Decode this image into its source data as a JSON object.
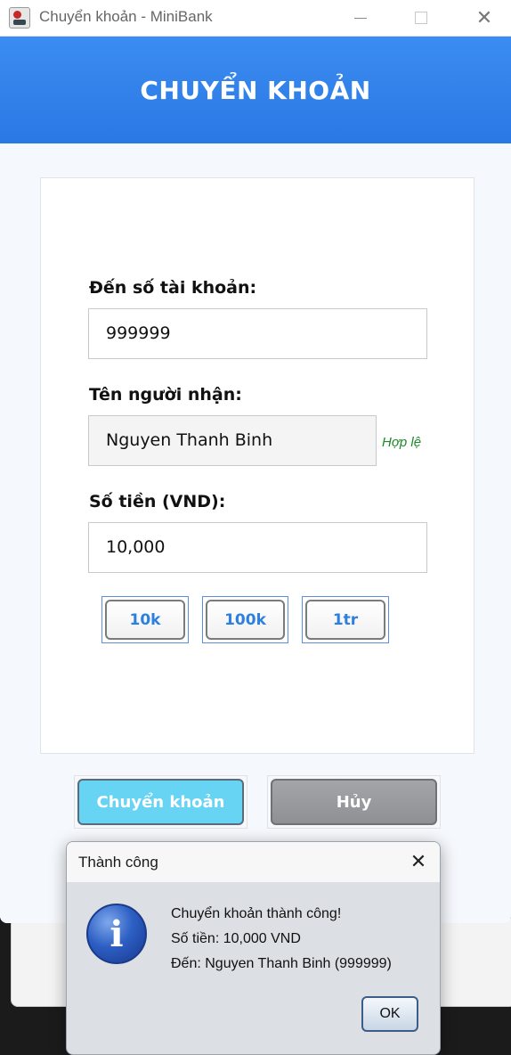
{
  "window": {
    "title": "Chuyển khoản - MiniBank"
  },
  "header": {
    "title": "CHUYỂN KHOẢN"
  },
  "form": {
    "account_label": "Đến số tài khoản:",
    "account_value": "999999",
    "recipient_label": "Tên người nhận:",
    "recipient_value": "Nguyen Thanh Binh",
    "recipient_status": "Hợp lệ",
    "amount_label": "Số tiền (VND):",
    "amount_value": "10,000",
    "quick_amounts": [
      "10k",
      "100k",
      "1tr"
    ]
  },
  "actions": {
    "transfer_label": "Chuyển khoản",
    "cancel_label": "Hủy"
  },
  "dialog": {
    "title": "Thành công",
    "line1": "Chuyển khoản thành công!",
    "line2": "Số tiền: 10,000 VND",
    "line3": "Đến: Nguyen Thanh Binh (999999)",
    "ok_label": "OK",
    "icon": "info-icon"
  },
  "colors": {
    "header": "#2a78e4",
    "transfer_button": "#67d4f4",
    "cancel_button": "#8e9094",
    "valid_text": "#1e8a28",
    "quick_button_text": "#2d7fe0"
  }
}
